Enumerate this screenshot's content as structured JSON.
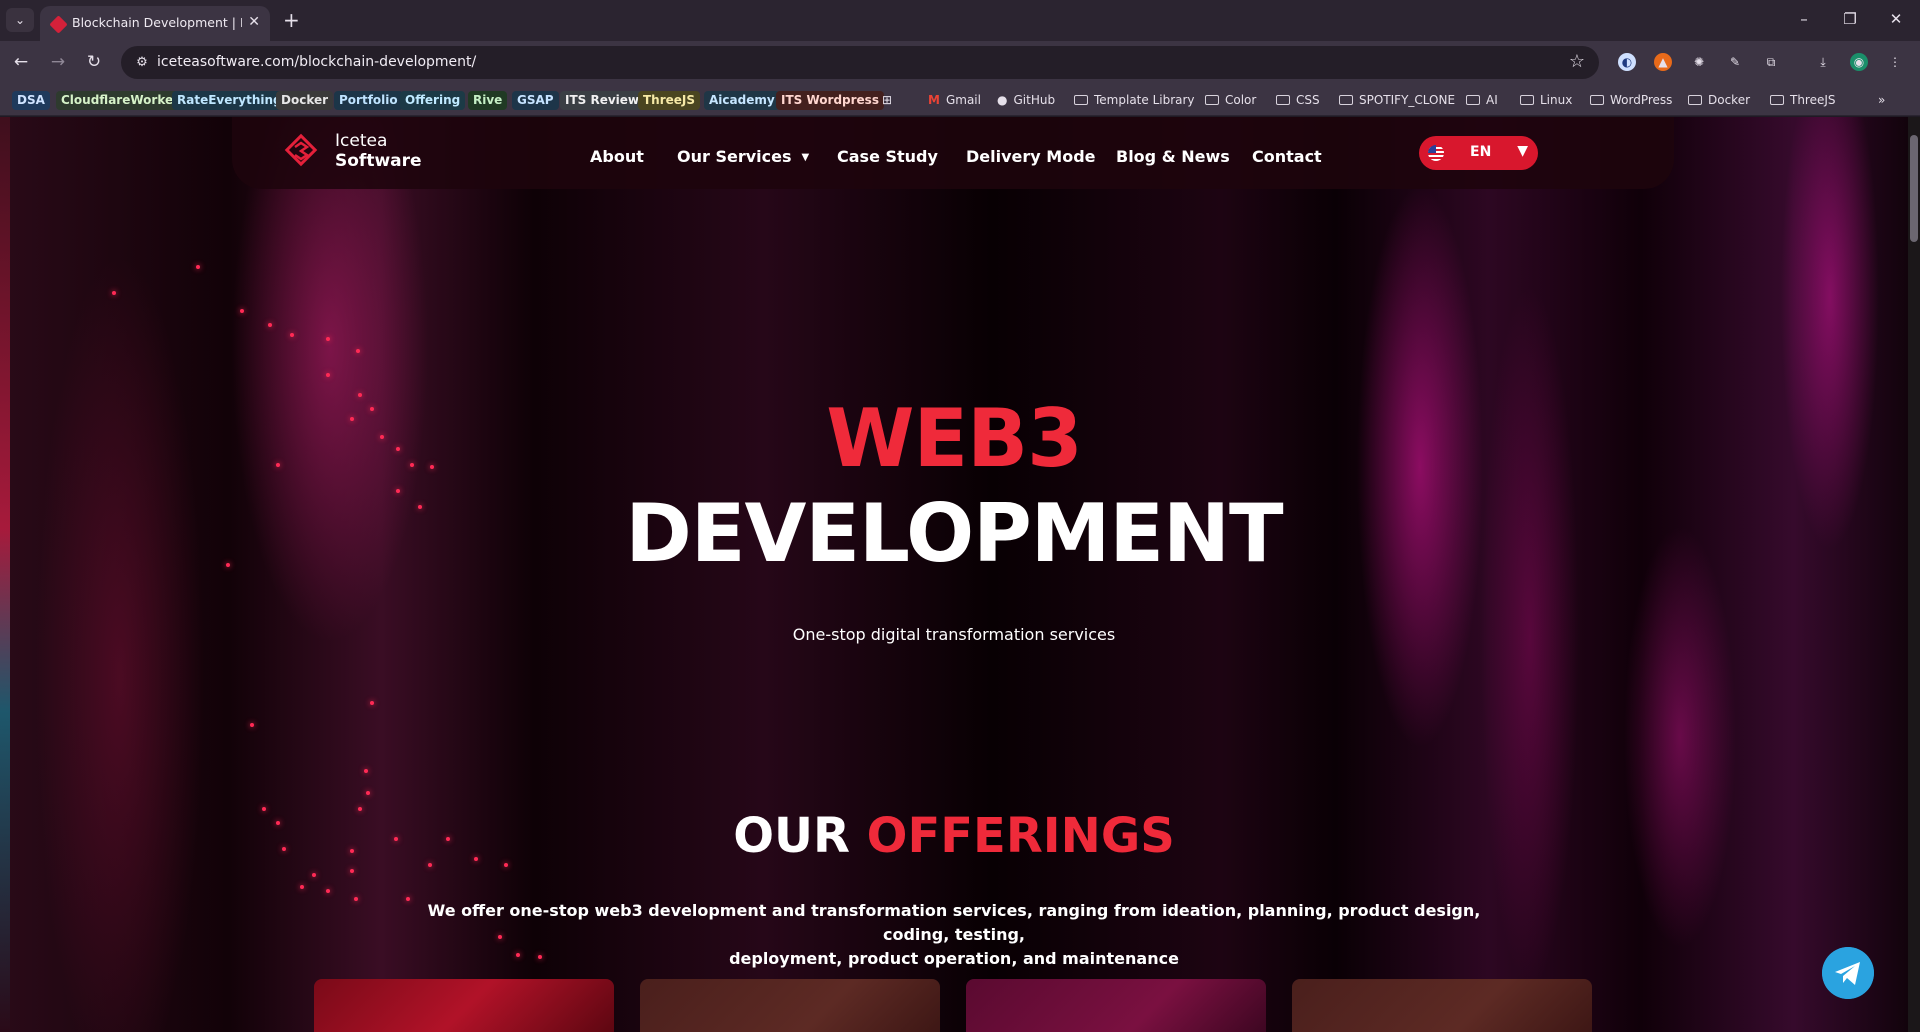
{
  "browser": {
    "tab_title": "Blockchain Development | Icetea Software",
    "url": "iceteasoftware.com/blockchain-development/",
    "bookmarks": [
      {
        "label": "DSA",
        "bg": "#1f3a5c",
        "color": "#cfe3ff"
      },
      {
        "label": "CloudflareWorker",
        "bg": "#2e3a2e",
        "color": "#d6f2c8"
      },
      {
        "label": "RateEverything",
        "bg": "#1c3747",
        "color": "#bfe7ff"
      },
      {
        "label": "Docker",
        "bg": "#3a3a3a",
        "color": "#e6e6e6"
      },
      {
        "label": "Portfolio",
        "bg": "#1c3548",
        "color": "#bfe3ff"
      },
      {
        "label": "Offering",
        "bg": "#1c3a46",
        "color": "#bfeaff"
      },
      {
        "label": "Rive",
        "bg": "#203a24",
        "color": "#c6f0c6"
      },
      {
        "label": "GSAP",
        "bg": "#1d3549",
        "color": "#c6e3ff"
      },
      {
        "label": "ITS Review",
        "bg": "#3a3f44",
        "color": "#f0f0f0"
      },
      {
        "label": "ThreeJS",
        "bg": "#4a4520",
        "color": "#f6e9a6"
      },
      {
        "label": "Aicademy",
        "bg": "#1f3646",
        "color": "#c6e6ff"
      },
      {
        "label": "ITS Wordpress",
        "bg": "#43201e",
        "color": "#ffd6cf"
      }
    ],
    "bookmark_links": [
      {
        "label": "Gmail",
        "icon": "gmail-icon"
      },
      {
        "label": "GitHub",
        "icon": "github-icon"
      }
    ],
    "bookmark_folders": [
      "Template Library",
      "Color",
      "CSS",
      "SPOTIFY_CLONE",
      "AI",
      "Linux",
      "WordPress",
      "Docker",
      "ThreeJS"
    ]
  },
  "site": {
    "logo_line1": "Icetea",
    "logo_line2": "Software",
    "nav": [
      "About",
      "Our Services",
      "Case Study",
      "Delivery Mode",
      "Blog & News",
      "Contact"
    ],
    "language": "EN"
  },
  "hero": {
    "line1": "WEB3",
    "line2": "DEVELOPMENT",
    "subtitle": "One-stop digital transformation services"
  },
  "offerings": {
    "title_plain": "OUR",
    "title_accent": "OFFERINGS",
    "description_line1": "We offer one-stop web3 development and transformation services, ranging from ideation, planning, product design, coding, testing,",
    "description_line2": "deployment, product operation, and maintenance"
  },
  "colors": {
    "accent": "#ef2a3a",
    "lang_pill": "#d8172d",
    "telegram": "#2aa3e0"
  }
}
